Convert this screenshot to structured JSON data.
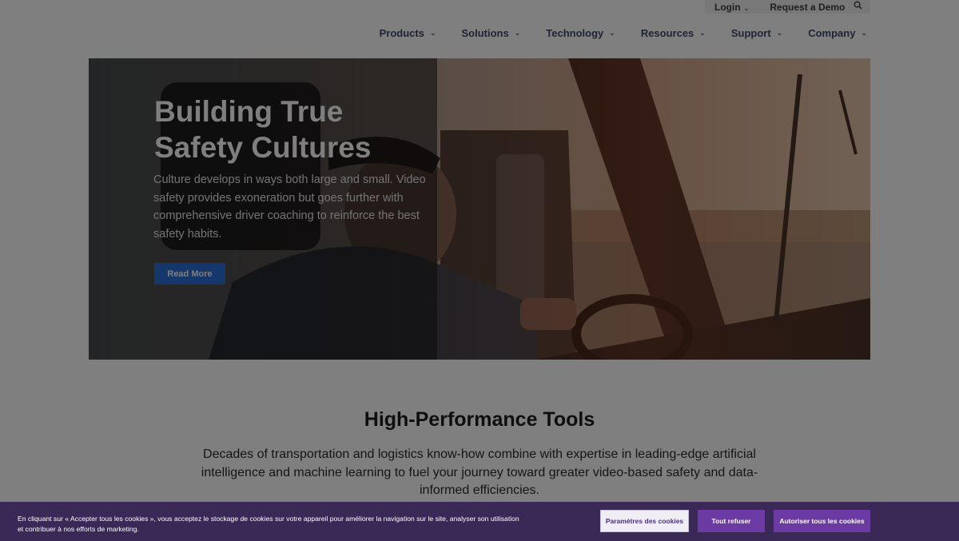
{
  "utility": {
    "login_label": "Login",
    "demo_label": "Request a Demo"
  },
  "nav": {
    "items": [
      {
        "label": "Products"
      },
      {
        "label": "Solutions"
      },
      {
        "label": "Technology"
      },
      {
        "label": "Resources"
      },
      {
        "label": "Support"
      },
      {
        "label": "Company"
      }
    ]
  },
  "hero": {
    "title_line1": "Building True",
    "title_line2": "Safety Cultures",
    "text": "Culture develops in ways both large and small. Video safety provides exoneration but goes further with comprehensive driver coaching to reinforce the best safety habits.",
    "button_label": "Read More"
  },
  "section": {
    "title": "High-Performance Tools",
    "text": "Decades of transportation and logistics know-how combine with expertise in leading-edge artificial intelligence and machine learning to fuel your journey toward greater video-based safety and data-informed efficiencies."
  },
  "cookie": {
    "text_line1": "En cliquant sur « Accepter tous les cookies », vous acceptez le stockage de cookies sur votre appareil pour améliorer la navigation sur le site, analyser son utilisation",
    "text_line2": "et contribuer à nos efforts de marketing.",
    "settings_label": "Paramètres des cookies",
    "refuse_label": "Tout refuser",
    "accept_label": "Autoriser tous les cookies"
  },
  "colors": {
    "brand_blue": "#2a6fd6",
    "cookie_bg": "#3a2857",
    "cookie_button": "#6b3aa3"
  },
  "icons": [
    "chevron-down-icon",
    "search-icon"
  ]
}
